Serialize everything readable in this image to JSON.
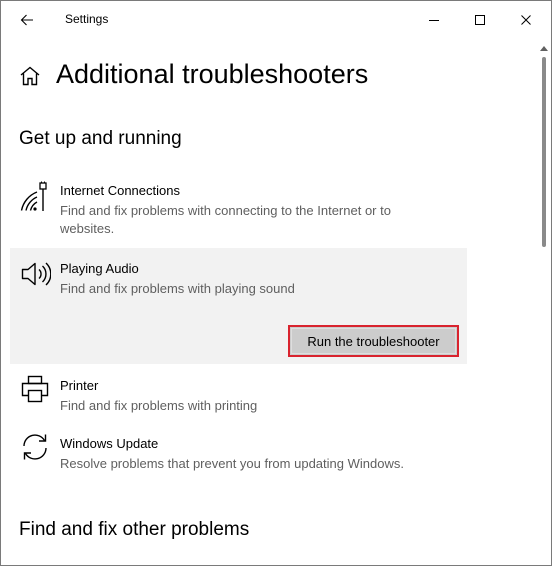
{
  "window": {
    "title": "Settings",
    "back_icon": "back-arrow-icon",
    "minimize_icon": "minimize-icon",
    "maximize_icon": "maximize-icon",
    "close_icon": "close-icon"
  },
  "header": {
    "home_icon": "home-icon",
    "title": "Additional troubleshooters"
  },
  "sections": [
    {
      "heading": "Get up and running",
      "items": [
        {
          "icon": "wifi-cable-icon",
          "name": "Internet Connections",
          "description": "Find and fix problems with connecting to the Internet or to websites."
        },
        {
          "icon": "speaker-icon",
          "name": "Playing Audio",
          "description": "Find and fix problems with playing sound",
          "selected": true,
          "action_label": "Run the troubleshooter"
        },
        {
          "icon": "printer-icon",
          "name": "Printer",
          "description": "Find and fix problems with printing"
        },
        {
          "icon": "refresh-icon",
          "name": "Windows Update",
          "description": "Resolve problems that prevent you from updating Windows."
        }
      ]
    },
    {
      "heading": "Find and fix other problems"
    }
  ],
  "colors": {
    "selected_bg": "#f2f2f2",
    "button_bg": "#cccccc",
    "highlight_border": "#d9232e",
    "desc_text": "#5f5f5f"
  }
}
